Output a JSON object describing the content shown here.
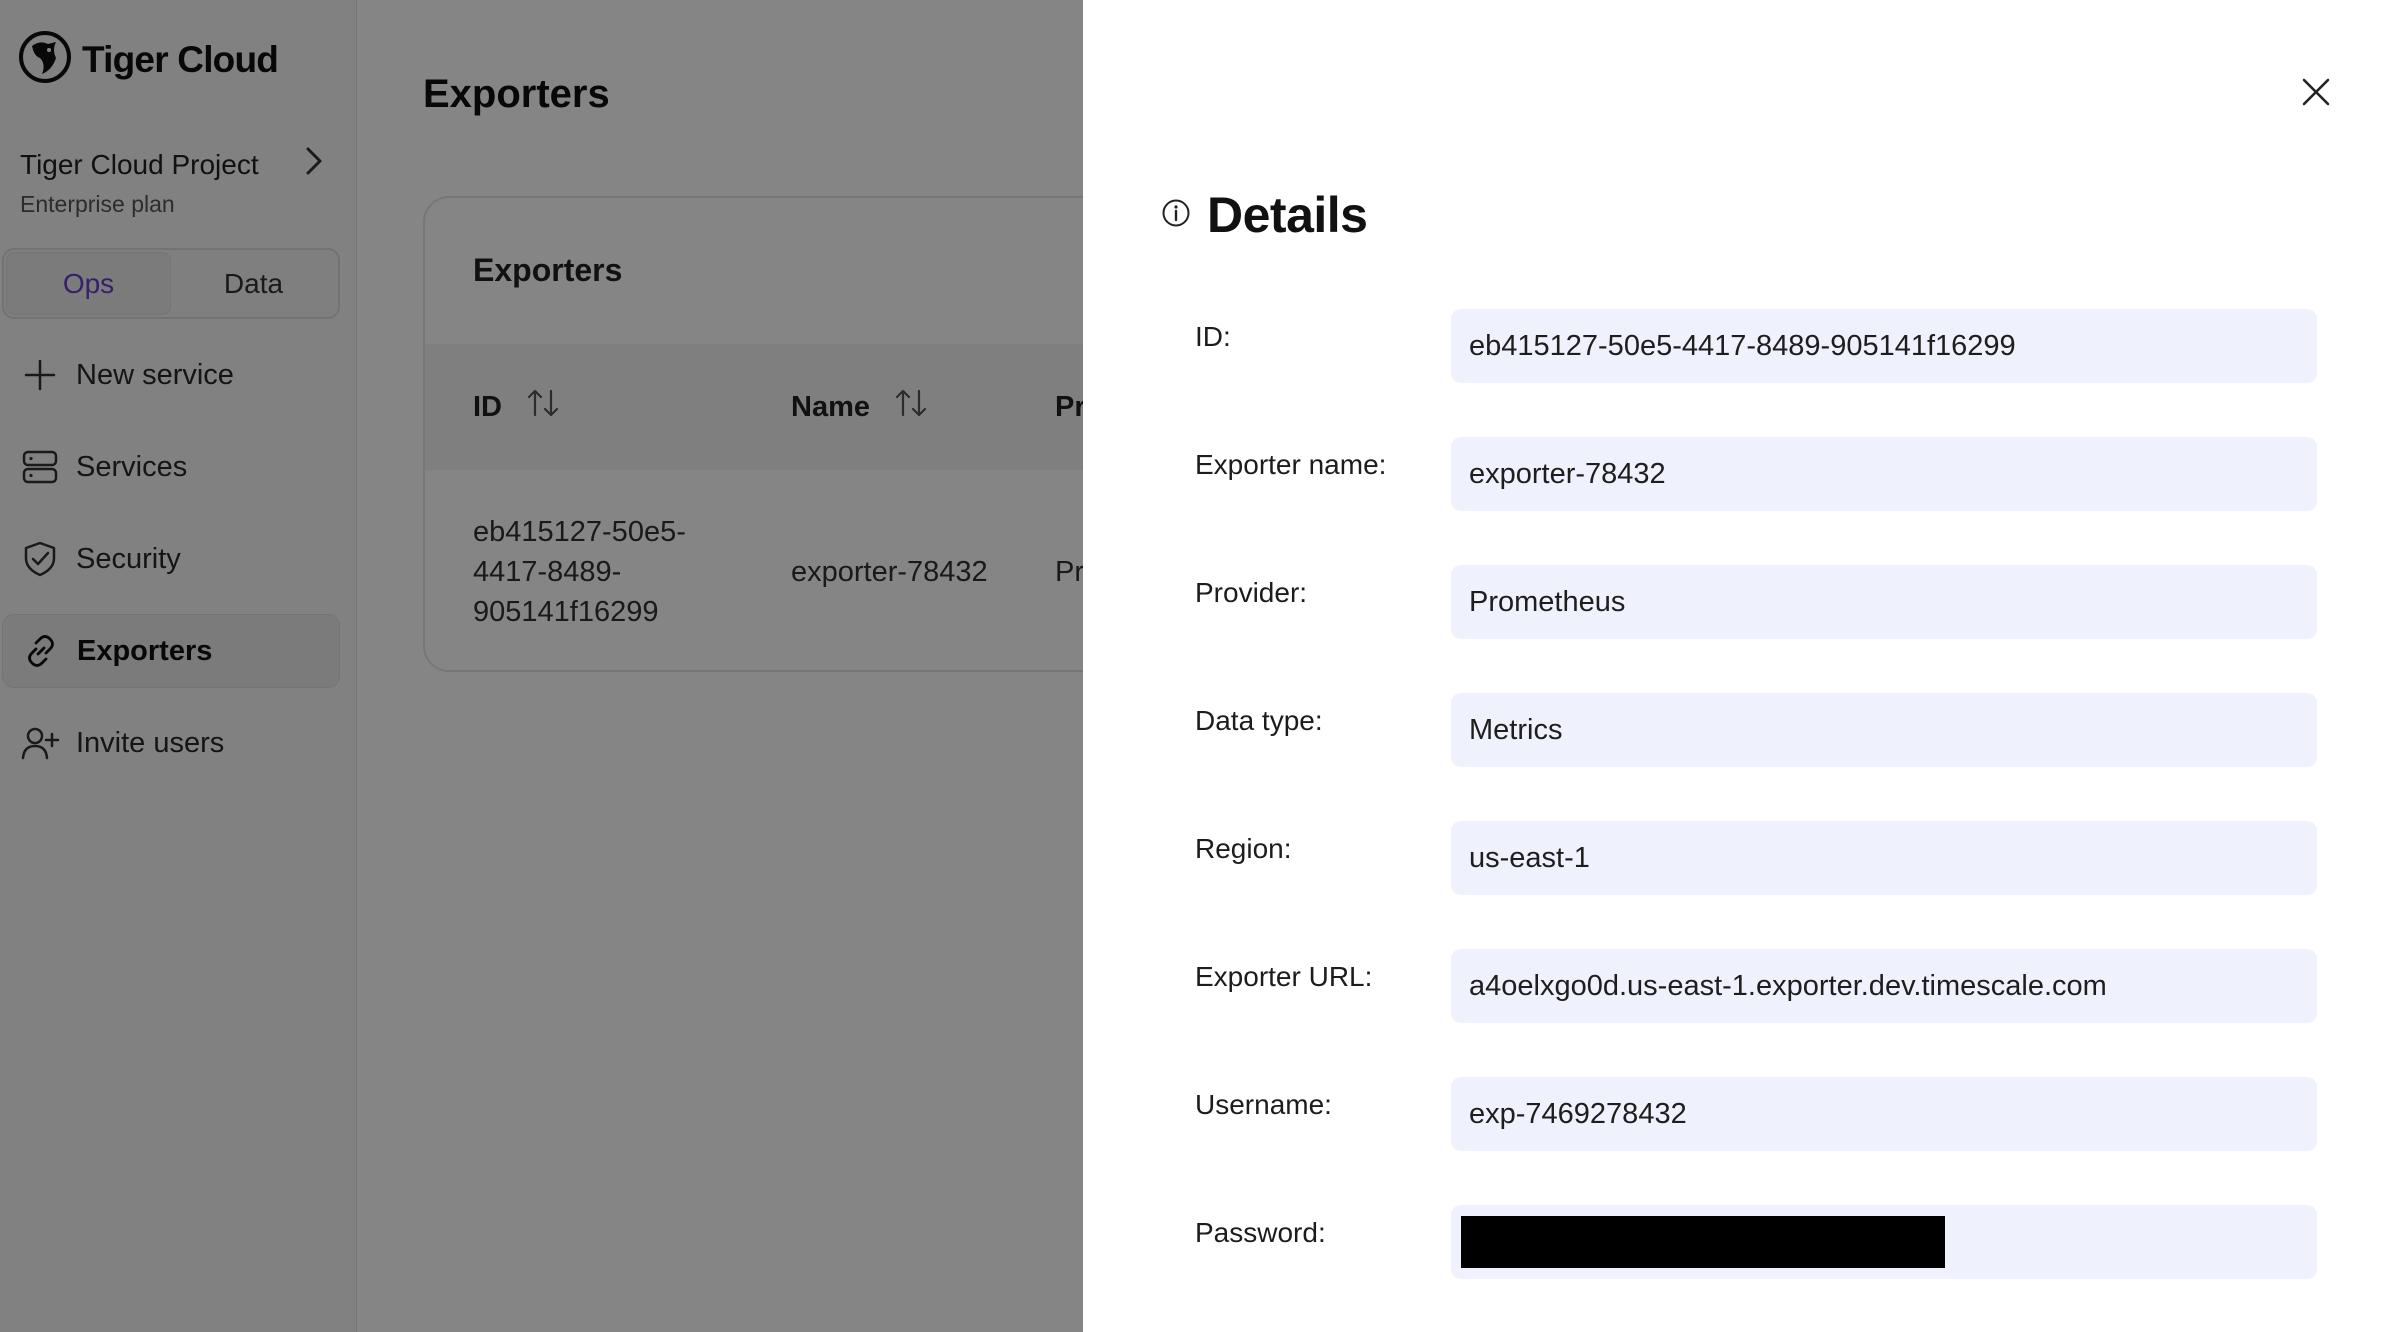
{
  "app": {
    "name": "Tiger Cloud"
  },
  "project": {
    "name": "Tiger Cloud Project",
    "plan": "Enterprise plan"
  },
  "tabs": [
    {
      "label": "Ops",
      "active": true
    },
    {
      "label": "Data",
      "active": false
    }
  ],
  "nav": {
    "new_service": "New service",
    "services": "Services",
    "security": "Security",
    "exporters": "Exporters",
    "invite_users": "Invite users"
  },
  "main": {
    "title": "Exporters",
    "card_title": "Exporters",
    "columns": {
      "id": "ID",
      "name": "Name",
      "provider_partial": "Pr"
    },
    "row": {
      "id_lines": [
        "eb415127-50e5-",
        "4417-8489-",
        "905141f16299"
      ],
      "name": "exporter-78432",
      "provider_partial": "Pr"
    }
  },
  "details": {
    "title": "Details",
    "fields": [
      {
        "label": "ID:",
        "value": "eb415127-50e5-4417-8489-905141f16299"
      },
      {
        "label": "Exporter name:",
        "value": "exporter-78432"
      },
      {
        "label": "Provider:",
        "value": "Prometheus"
      },
      {
        "label": "Data type:",
        "value": "Metrics"
      },
      {
        "label": "Region:",
        "value": "us-east-1"
      },
      {
        "label": "Exporter URL:",
        "value": "a4oelxgo0d.us-east-1.exporter.dev.timescale.com"
      },
      {
        "label": "Username:",
        "value": "exp-7469278432"
      },
      {
        "label": "Password:",
        "value": ""
      }
    ]
  },
  "colors": {
    "accent": "#6a3fc9",
    "field_bg": "#eff1fc",
    "overlay": "rgba(0,0,0,0.48)"
  }
}
